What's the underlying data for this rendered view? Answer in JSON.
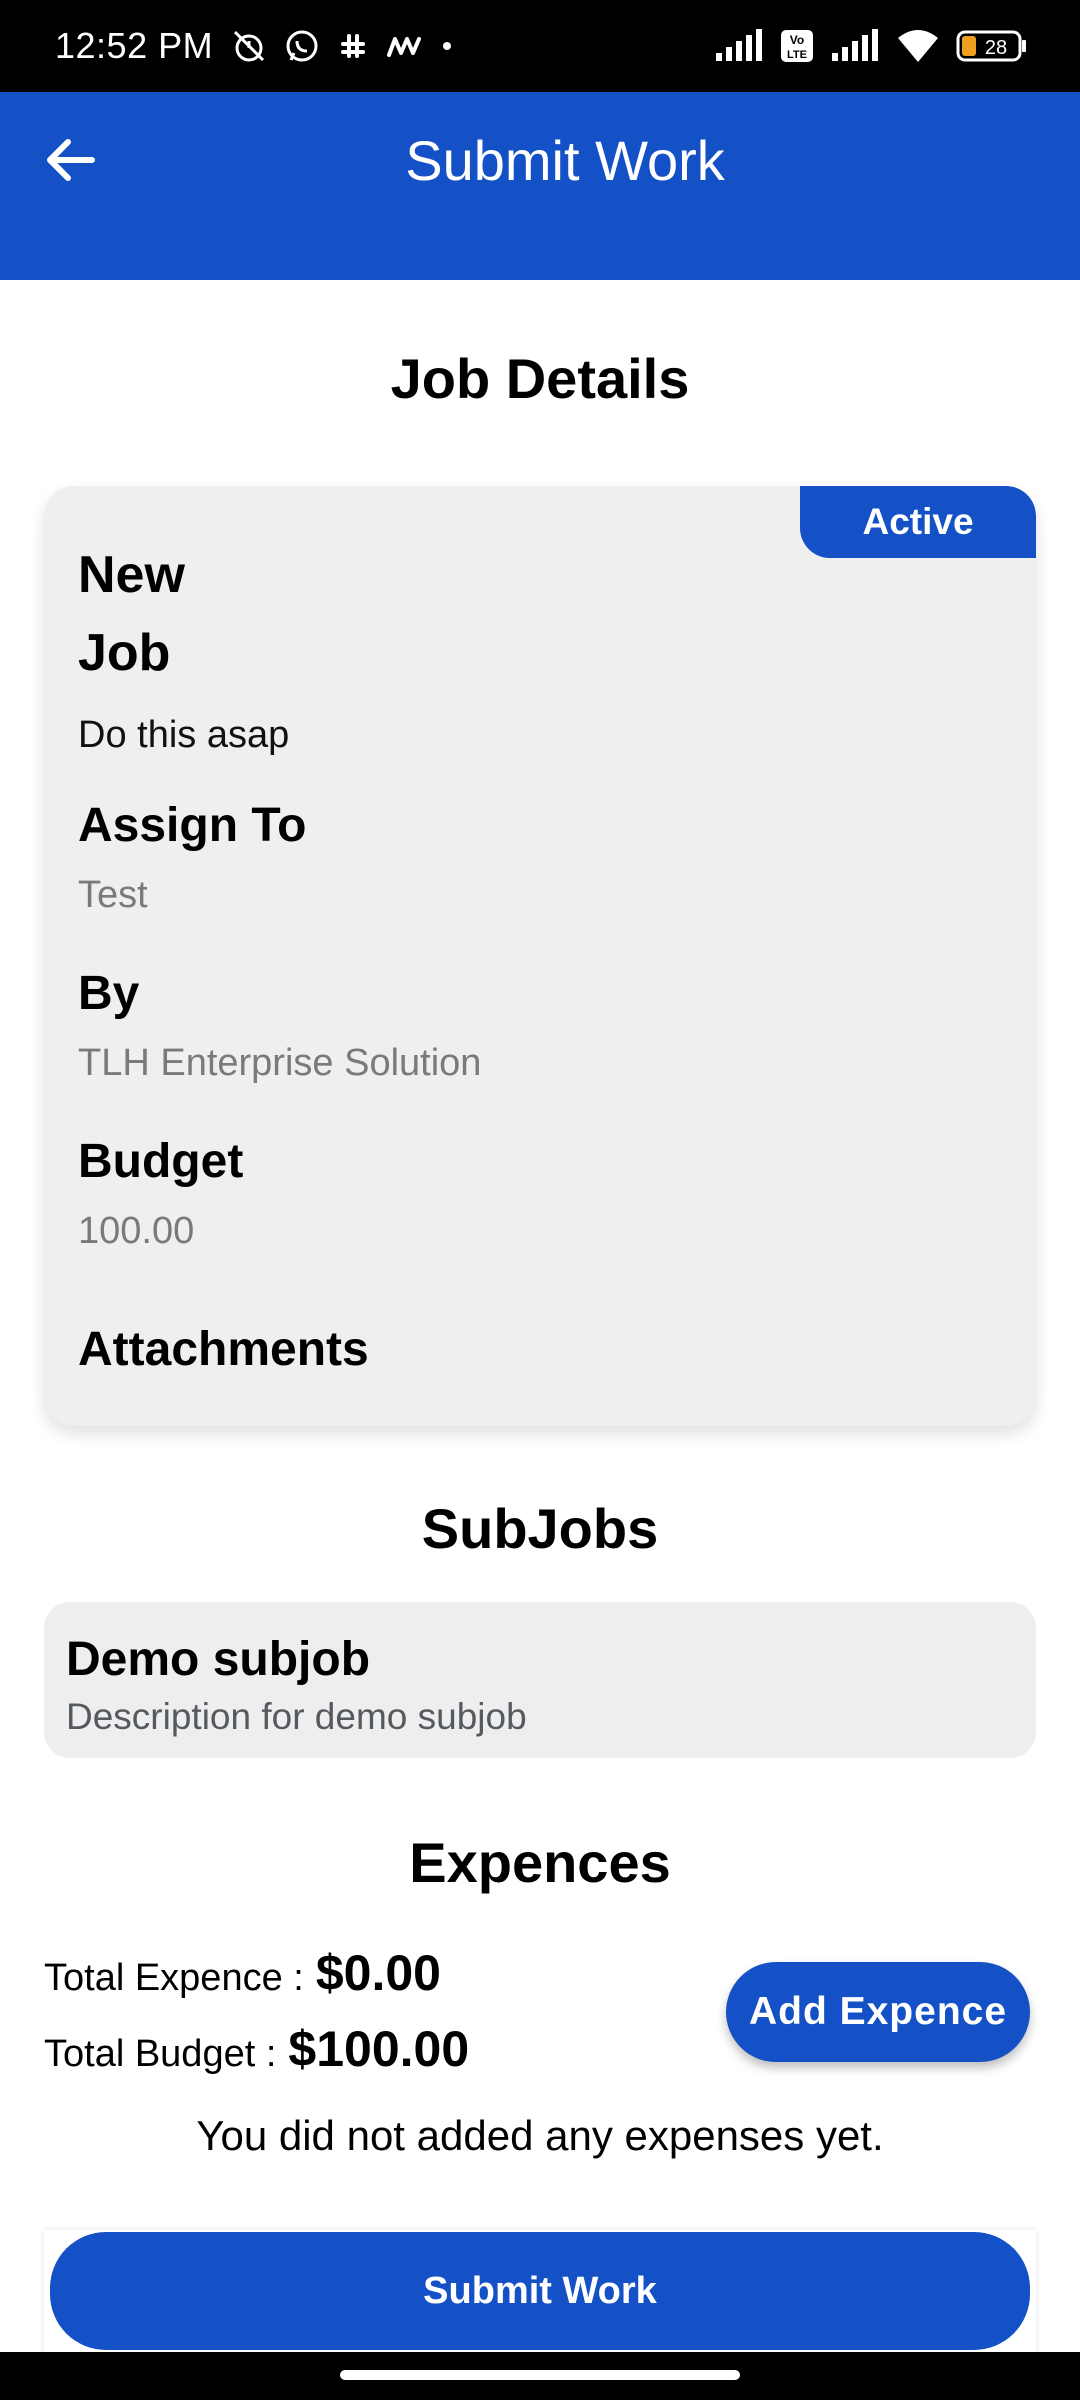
{
  "status_bar": {
    "time": "12:52 PM",
    "battery": "28",
    "volte": "Vo LTE"
  },
  "app_bar": {
    "title": "Submit Work"
  },
  "job_details": {
    "section_title": "Job Details",
    "status_badge": "Active",
    "name": "New Job",
    "description": "Do this asap",
    "assign_to_label": "Assign To",
    "assign_to_value": "Test",
    "by_label": "By",
    "by_value": "TLH Enterprise Solution",
    "budget_label": "Budget",
    "budget_value": "100.00",
    "attachments_label": "Attachments"
  },
  "subjobs": {
    "section_title": "SubJobs",
    "items": [
      {
        "title": "Demo subjob",
        "description": "Description for demo subjob"
      }
    ]
  },
  "expenses": {
    "section_title": "Expences",
    "total_expense_label": "Total Expence :",
    "total_expense_value": "$0.00",
    "total_budget_label": "Total Budget :",
    "total_budget_value": "$100.00",
    "add_button": "Add Expence",
    "empty_message": "You did not added any expenses yet."
  },
  "footer": {
    "submit_button": "Submit Work"
  },
  "colors": {
    "primary": "#1551c6",
    "card_bg": "#efefef"
  }
}
